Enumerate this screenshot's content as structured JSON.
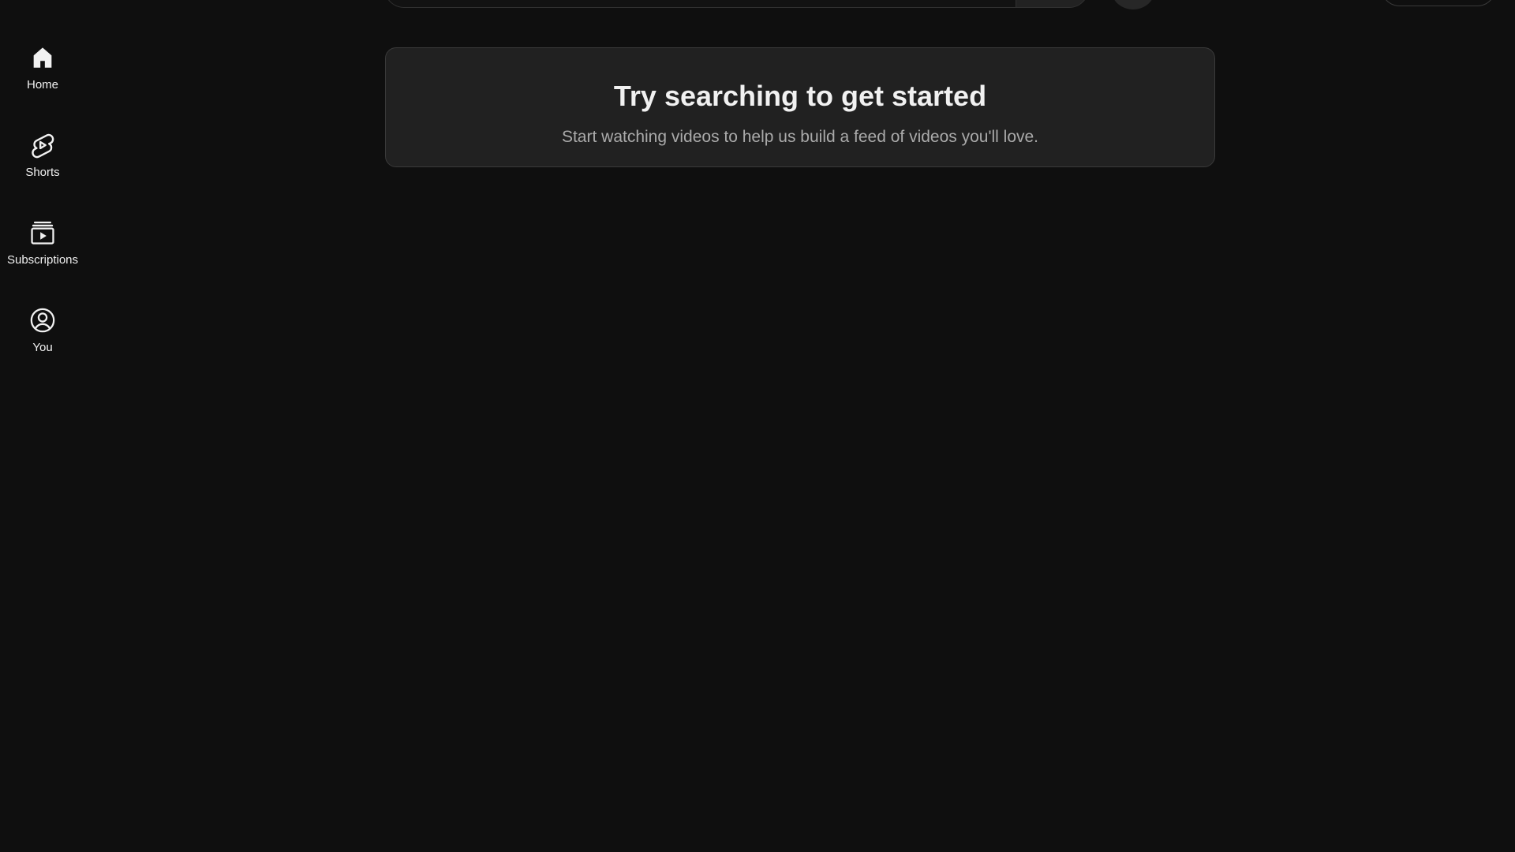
{
  "guide": {
    "items": [
      {
        "label": "Home",
        "icon": "home-icon"
      },
      {
        "label": "Shorts",
        "icon": "shorts-icon"
      },
      {
        "label": "Subscriptions",
        "icon": "subscriptions-icon"
      },
      {
        "label": "You",
        "icon": "account-circle-icon"
      }
    ]
  },
  "promo": {
    "title": "Try searching to get started",
    "subtitle": "Start watching videos to help us build a feed of videos you'll love."
  },
  "colors": {
    "background": "#0f0f0f",
    "card": "#212121",
    "card_border": "#3a3a3a",
    "text_primary": "#f1f1f1",
    "text_secondary": "#aaaaaa"
  }
}
